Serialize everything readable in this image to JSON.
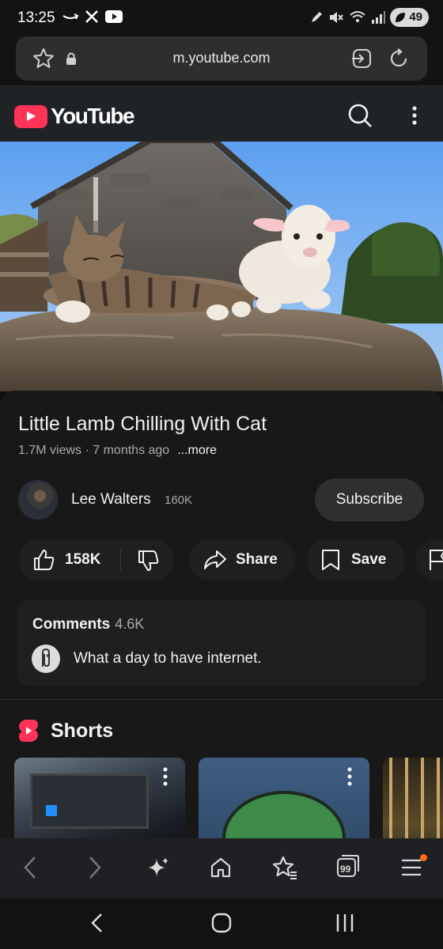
{
  "status_bar": {
    "time": "13:25",
    "battery": "49",
    "icons": [
      "amazon-icon",
      "x-icon",
      "youtube-icon",
      "pen-icon",
      "mute-icon",
      "wifi-icon",
      "signal-icon",
      "battery-icon"
    ]
  },
  "browser": {
    "url": "m.youtube.com"
  },
  "youtube": {
    "logo_text": "YouTube",
    "brand_color": "#ff3358"
  },
  "video": {
    "title": "Little Lamb Chilling With Cat",
    "views": "1.7M views",
    "age": "7 months ago",
    "meta_separator": " · ",
    "more_label": "...more"
  },
  "channel": {
    "name": "Lee Walters",
    "subscribers": "160K",
    "subscribe_label": "Subscribe"
  },
  "actions": {
    "likes": "158K",
    "share_label": "Share",
    "save_label": "Save"
  },
  "comments": {
    "title": "Comments",
    "count": "4.6K",
    "top_comment": "What a day to have internet."
  },
  "shorts": {
    "title": "Shorts"
  },
  "browser_bottom": {
    "tabs_count": "99",
    "menu_badge_color": "#ff6a1a"
  }
}
